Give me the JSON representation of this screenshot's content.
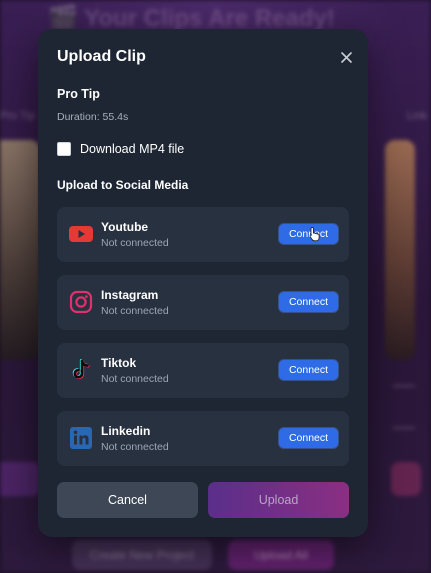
{
  "background": {
    "title": "🎬 Your Clips Are Ready!",
    "left_label": "Pro Tip",
    "right_label": "Link",
    "create_button": "Create New Project",
    "upload_all_button": "Upload All"
  },
  "modal": {
    "title": "Upload Clip",
    "close_icon": "close-icon",
    "clip": {
      "name": "Pro Tip",
      "duration": "Duration: 55.4s"
    },
    "download": {
      "label": "Download MP4 file",
      "checked": false
    },
    "section_title": "Upload to Social Media",
    "platforms": [
      {
        "name": "Youtube",
        "status": "Not connected",
        "button": "Connect",
        "icon": "youtube-icon",
        "color": "#e53935"
      },
      {
        "name": "Instagram",
        "status": "Not connected",
        "button": "Connect",
        "icon": "instagram-icon",
        "color": "#e1306c"
      },
      {
        "name": "Tiktok",
        "status": "Not connected",
        "button": "Connect",
        "icon": "tiktok-icon",
        "color": "#000000"
      },
      {
        "name": "Linkedin",
        "status": "Not connected",
        "button": "Connect",
        "icon": "linkedin-icon",
        "color": "#2867b2"
      }
    ],
    "cancel_label": "Cancel",
    "upload_label": "Upload"
  },
  "colors": {
    "modal_bg": "#1e2633",
    "card_bg": "#283140",
    "connect_blue": "#2f6be6",
    "upload_gradient_start": "#5a2f8a",
    "upload_gradient_end": "#8a2f82"
  }
}
